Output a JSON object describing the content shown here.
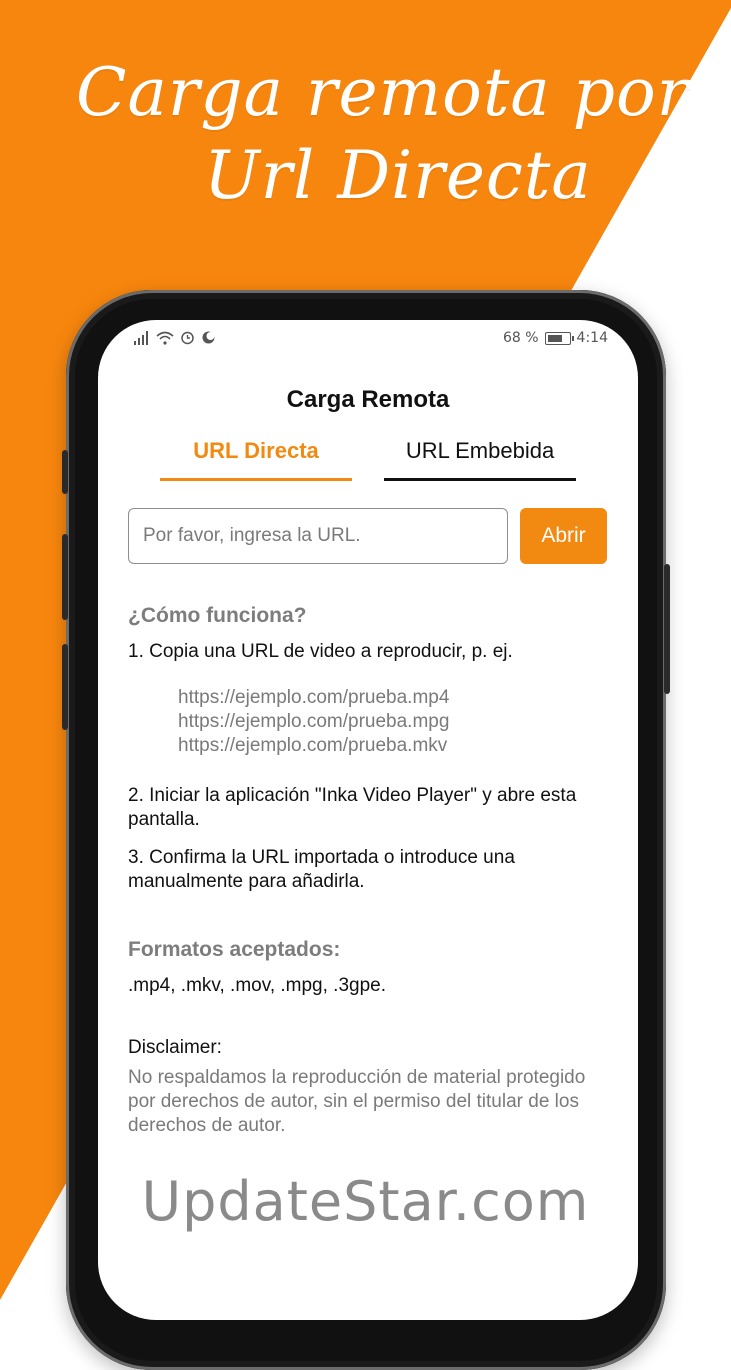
{
  "colors": {
    "accent": "#f28a12",
    "background_shape": "#f7860e"
  },
  "headline": {
    "line1": "Carga remota por",
    "line2": "Url Directa"
  },
  "status_bar": {
    "left_icons": [
      "signal-icon",
      "wifi-icon",
      "alarm-icon",
      "sync-icon"
    ],
    "battery_percent": "68 %",
    "time": "4:14"
  },
  "screen": {
    "title": "Carga Remota",
    "tabs": [
      {
        "label": "URL Directa",
        "active": true
      },
      {
        "label": "URL Embebida",
        "active": false
      }
    ],
    "url_input": {
      "placeholder": "Por favor, ingresa la URL.",
      "value": ""
    },
    "open_button": "Abrir",
    "how_it_works": {
      "heading": "¿Cómo funciona?",
      "step1": "1. Copia una URL de video a reproducir, p. ej.",
      "examples": [
        "https://ejemplo.com/prueba.mp4",
        "https://ejemplo.com/prueba.mpg",
        "https://ejemplo.com/prueba.mkv"
      ],
      "step2": "2. Iniciar la aplicación \"Inka Video Player\" y abre esta pantalla.",
      "step3": "3. Confirma la URL importada o introduce una manualmente para añadirla."
    },
    "formats": {
      "heading": "Formatos aceptados:",
      "list": ".mp4, .mkv, .mov, .mpg, .3gpe."
    },
    "disclaimer": {
      "heading": "Disclaimer:",
      "text": "No respaldamos la reproducción de material protegido por derechos de autor, sin el permiso del titular de los derechos de autor."
    }
  },
  "watermark": "UpdateStar.com"
}
